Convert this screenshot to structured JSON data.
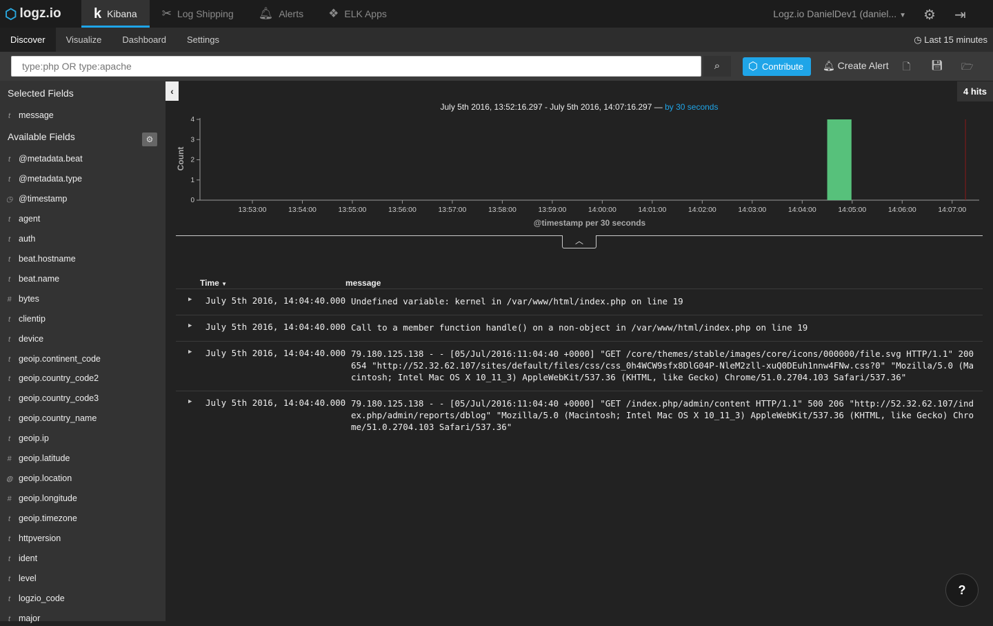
{
  "top": {
    "brand": "logz.io",
    "tabs": [
      {
        "label": "Kibana",
        "icon": "kibana-icon"
      },
      {
        "label": "Log Shipping",
        "icon": "tools-icon"
      },
      {
        "label": "Alerts",
        "icon": "bell-icon"
      },
      {
        "label": "ELK Apps",
        "icon": "cubes-icon"
      }
    ],
    "user": "Logz.io DanielDev1 (daniel..."
  },
  "subnav": {
    "items": [
      "Discover",
      "Visualize",
      "Dashboard",
      "Settings"
    ],
    "time": "Last 15 minutes"
  },
  "search": {
    "placeholder": "type:php OR type:apache",
    "contribute": "Contribute",
    "create_alert": "Create Alert"
  },
  "sidebar": {
    "selected_title": "Selected Fields",
    "selected": [
      {
        "type": "t",
        "name": "message"
      }
    ],
    "available_title": "Available Fields",
    "fields": [
      {
        "type": "t",
        "name": "@metadata.beat"
      },
      {
        "type": "t",
        "name": "@metadata.type"
      },
      {
        "type": "clock",
        "name": "@timestamp"
      },
      {
        "type": "t",
        "name": "agent"
      },
      {
        "type": "t",
        "name": "auth"
      },
      {
        "type": "t",
        "name": "beat.hostname"
      },
      {
        "type": "t",
        "name": "beat.name"
      },
      {
        "type": "#",
        "name": "bytes"
      },
      {
        "type": "t",
        "name": "clientip"
      },
      {
        "type": "t",
        "name": "device"
      },
      {
        "type": "t",
        "name": "geoip.continent_code"
      },
      {
        "type": "t",
        "name": "geoip.country_code2"
      },
      {
        "type": "t",
        "name": "geoip.country_code3"
      },
      {
        "type": "t",
        "name": "geoip.country_name"
      },
      {
        "type": "t",
        "name": "geoip.ip"
      },
      {
        "type": "#",
        "name": "geoip.latitude"
      },
      {
        "type": "globe",
        "name": "geoip.location"
      },
      {
        "type": "#",
        "name": "geoip.longitude"
      },
      {
        "type": "t",
        "name": "geoip.timezone"
      },
      {
        "type": "t",
        "name": "httpversion"
      },
      {
        "type": "t",
        "name": "ident"
      },
      {
        "type": "t",
        "name": "level"
      },
      {
        "type": "t",
        "name": "logzio_code"
      },
      {
        "type": "t",
        "name": "major"
      }
    ]
  },
  "hits": "4 hits",
  "range": {
    "text": "July 5th 2016, 13:52:16.297 - July 5th 2016, 14:07:16.297 —",
    "interval": "by 30 seconds"
  },
  "chart_data": {
    "type": "bar",
    "xlabel": "@timestamp per 30 seconds",
    "ylabel": "Count",
    "ylim": [
      0,
      4
    ],
    "yticks": [
      0,
      1,
      2,
      3,
      4
    ],
    "xticks": [
      "13:53:00",
      "13:54:00",
      "13:55:00",
      "13:56:00",
      "13:57:00",
      "13:58:00",
      "13:59:00",
      "14:00:00",
      "14:01:00",
      "14:02:00",
      "14:03:00",
      "14:04:00",
      "14:05:00",
      "14:06:00",
      "14:07:00"
    ],
    "xlim": [
      "13:52:00",
      "14:07:30"
    ],
    "bars": [
      {
        "x": "14:04:30",
        "width_seconds": 30,
        "value": 4
      }
    ],
    "now_marker": "14:07:16",
    "bar_color": "#57c17b",
    "marker_color": "#8b1a1a"
  },
  "table": {
    "columns": [
      "Time",
      "message"
    ],
    "rows": [
      {
        "time": "July 5th 2016, 14:04:40.000",
        "message": "Undefined variable: kernel in /var/www/html/index.php on line 19"
      },
      {
        "time": "July 5th 2016, 14:04:40.000",
        "message": "Call to a member function handle() on a non-object in /var/www/html/index.php on line 19"
      },
      {
        "time": "July 5th 2016, 14:04:40.000",
        "message": "79.180.125.138 - - [05/Jul/2016:11:04:40 +0000] \"GET /core/themes/stable/images/core/icons/000000/file.svg HTTP/1.1\" 200 654 \"http://52.32.62.107/sites/default/files/css/css_0h4WCW9sfx8DlG04P-NleM2zll-xuQ0DEuh1nnw4FNw.css?0\" \"Mozilla/5.0 (Macintosh; Intel Mac OS X 10_11_3) AppleWebKit/537.36 (KHTML, like Gecko) Chrome/51.0.2704.103 Safari/537.36\""
      },
      {
        "time": "July 5th 2016, 14:04:40.000",
        "message": "79.180.125.138 - - [05/Jul/2016:11:04:40 +0000] \"GET /index.php/admin/content HTTP/1.1\" 500 206 \"http://52.32.62.107/index.php/admin/reports/dblog\" \"Mozilla/5.0 (Macintosh; Intel Mac OS X 10_11_3) AppleWebKit/537.36 (KHTML, like Gecko) Chrome/51.0.2704.103 Safari/537.36\""
      }
    ]
  },
  "colors": {
    "accent": "#1fa5e8"
  }
}
